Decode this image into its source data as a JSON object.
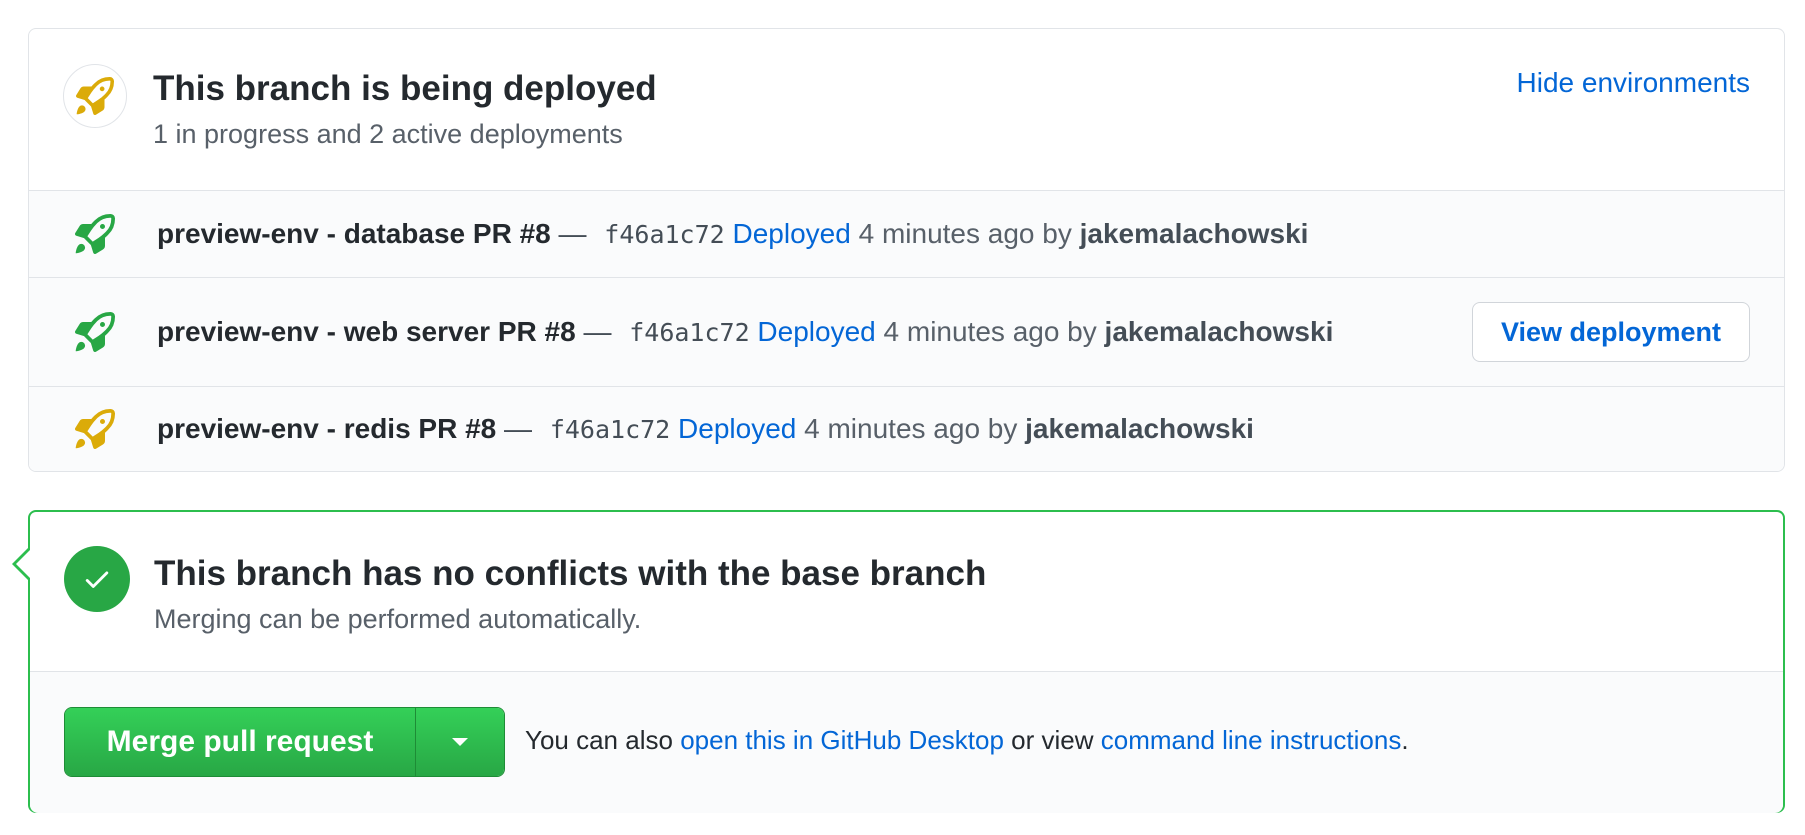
{
  "colors": {
    "link": "#0366d6",
    "success": "#28a745",
    "success_border": "#2cbe4e",
    "pending": "#dbab09",
    "border": "#e1e4e8",
    "muted_bg": "#fafbfc"
  },
  "deployments": {
    "header_icon": "rocket-icon",
    "title": "This branch is being deployed",
    "subtitle": "1 in progress and 2 active deployments",
    "hide_link": "Hide environments",
    "rows": [
      {
        "icon": "rocket-icon",
        "status_color": "#28a745",
        "name": "preview-env - database PR #8",
        "dash": "—",
        "sha": "f46a1c72",
        "state": "Deployed",
        "time": "4 minutes ago by",
        "user": "jakemalachowski"
      },
      {
        "icon": "rocket-icon",
        "status_color": "#28a745",
        "name": "preview-env - web server PR #8",
        "dash": "—",
        "sha": "f46a1c72",
        "state": "Deployed",
        "time": "4 minutes ago by",
        "user": "jakemalachowski",
        "button": "View deployment"
      },
      {
        "icon": "rocket-icon",
        "status_color": "#dbab09",
        "name": "preview-env - redis PR #8",
        "dash": "—",
        "sha": "f46a1c72",
        "state": "Deployed",
        "time": "4 minutes ago by",
        "user": "jakemalachowski"
      }
    ]
  },
  "merge": {
    "icon": "check-icon",
    "title": "This branch has no conflicts with the base branch",
    "subtitle": "Merging can be performed automatically.",
    "button_label": "Merge pull request",
    "dropdown_icon": "caret-down-icon",
    "note_prefix": "You can also",
    "desktop_link": "open this in GitHub Desktop",
    "note_middle": "or view",
    "cli_link": "command line instructions",
    "note_suffix": "."
  }
}
